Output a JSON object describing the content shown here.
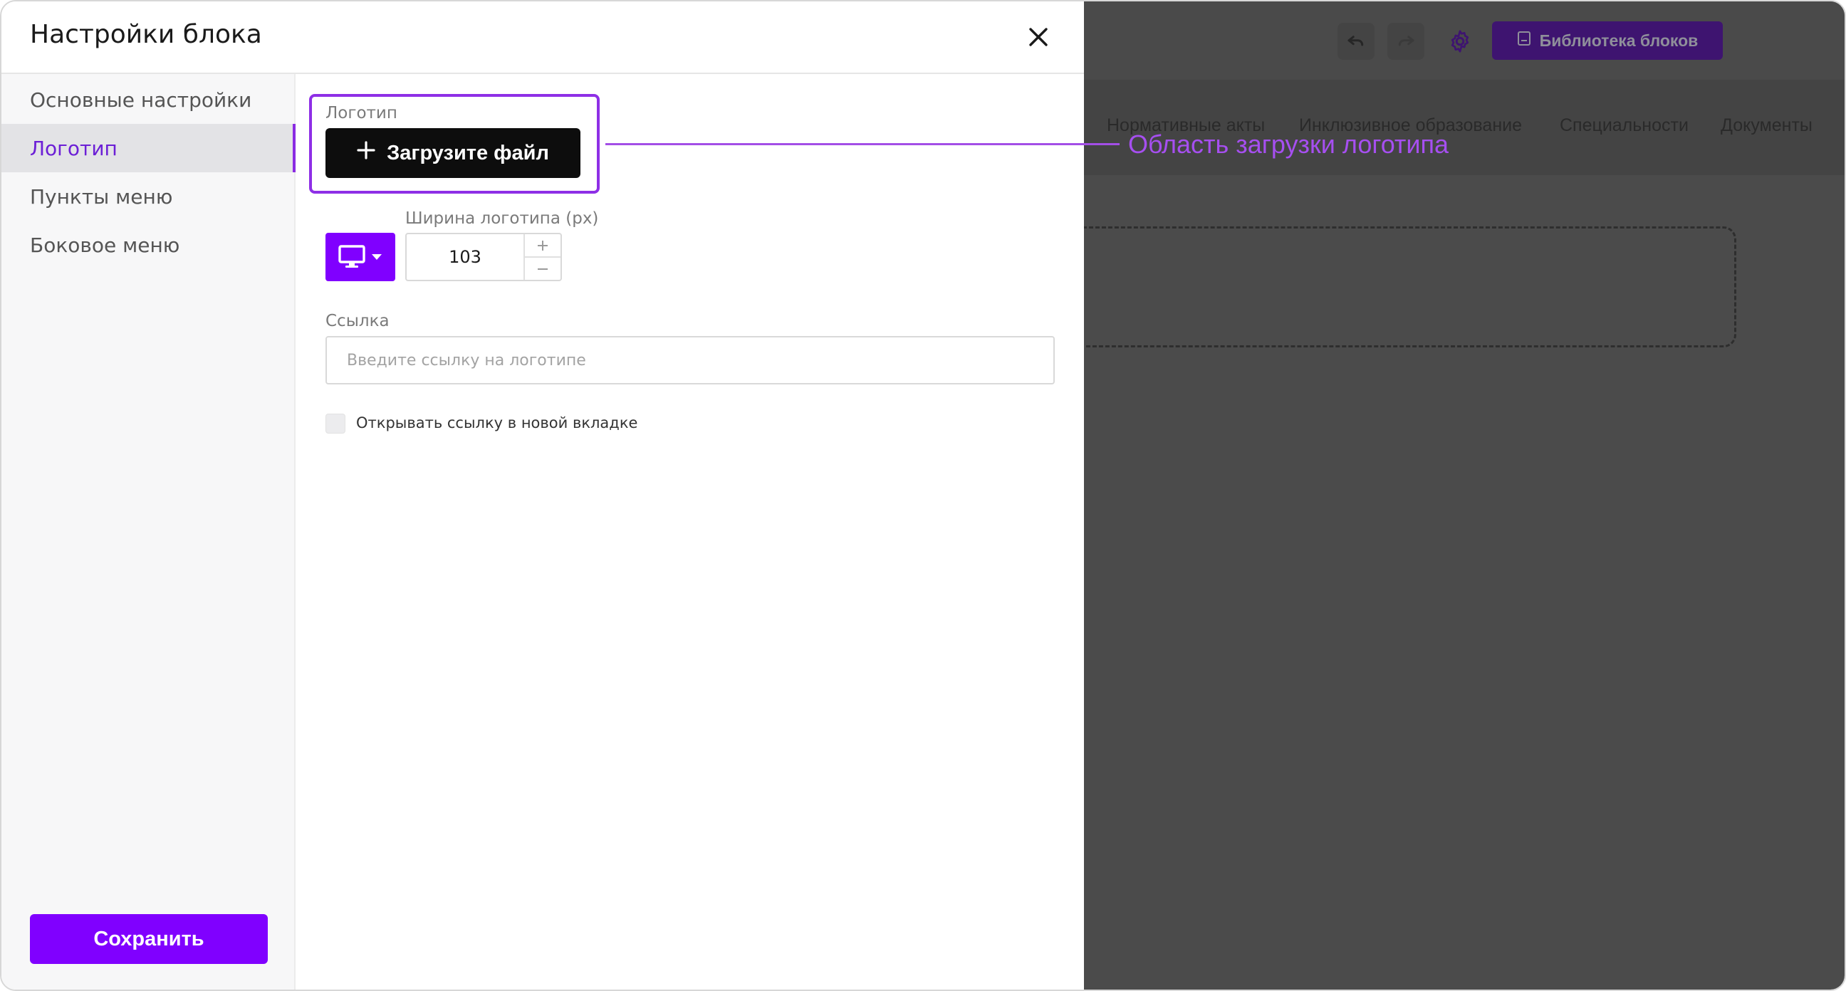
{
  "modal": {
    "title": "Настройки блока",
    "close_icon": "close-icon"
  },
  "sidebar": {
    "items": [
      {
        "label": "Основные настройки",
        "active": false
      },
      {
        "label": "Логотип",
        "active": true
      },
      {
        "label": "Пункты меню",
        "active": false
      },
      {
        "label": "Боковое меню",
        "active": false
      }
    ],
    "save_label": "Сохранить"
  },
  "logo": {
    "section_label": "Логотип",
    "upload_label": "Загрузите файл",
    "width_label": "Ширина логотипа (px)",
    "width_value": "103",
    "device_icon": "desktop-icon"
  },
  "link": {
    "label": "Ссылка",
    "placeholder": "Введите ссылку на логотипе",
    "value": ""
  },
  "open_new_tab": {
    "label": "Открывать ссылку в новой вкладке",
    "checked": false
  },
  "annotation": {
    "text": "Область загрузки логотипа",
    "color": "#a64ff0"
  },
  "background": {
    "library_label": "Библиотека блоков",
    "nav_items": [
      "Нормативные акты",
      "Инклюзивное образование",
      "Специальности",
      "Документы"
    ]
  },
  "colors": {
    "accent": "#8000ff",
    "annotation": "#a34ee6",
    "upload_button": "#0d0d0d"
  }
}
